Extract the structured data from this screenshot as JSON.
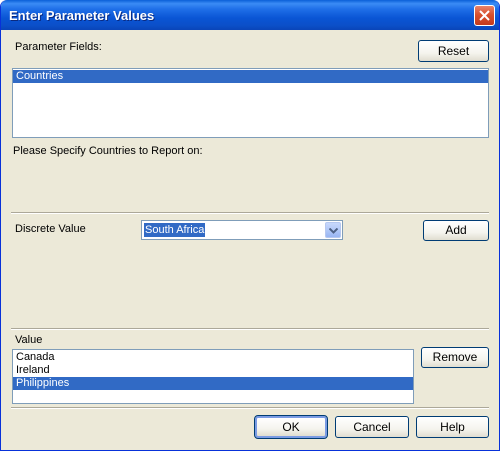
{
  "window": {
    "title": "Enter Parameter Values"
  },
  "parameter_fields": {
    "label": "Parameter Fields:",
    "reset_label": "Reset",
    "items": [
      {
        "label": "Countries",
        "selected": true
      }
    ]
  },
  "prompt_text": "Please Specify Countries to Report on:",
  "discrete": {
    "label": "Discrete Value",
    "selected_value": "South Africa",
    "add_label": "Add"
  },
  "value_list": {
    "label": "Value",
    "remove_label": "Remove",
    "items": [
      {
        "label": "Canada",
        "selected": false
      },
      {
        "label": "Ireland",
        "selected": false
      },
      {
        "label": "Philippines",
        "selected": true
      }
    ]
  },
  "footer": {
    "ok_label": "OK",
    "cancel_label": "Cancel",
    "help_label": "Help"
  },
  "colors": {
    "selection": "#316ac5",
    "dialog_bg": "#ece9d8",
    "titlebar": "#0a55d5"
  }
}
